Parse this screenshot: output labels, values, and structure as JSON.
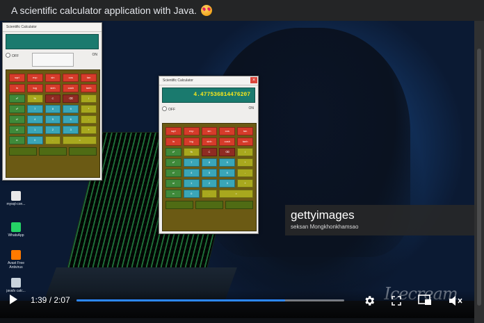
{
  "post": {
    "caption": "A scientific calculator application with Java."
  },
  "desktop_icons": [
    {
      "label": "mysql-con...",
      "color": "#e8e8e8"
    },
    {
      "label": "WhatsApp",
      "color": "#25d366"
    },
    {
      "label": "Avast Free Antivirus",
      "color": "#ff7a00"
    },
    {
      "label": "javafx calc...",
      "color": "#c9d3dc"
    }
  ],
  "calc_small": {
    "title": "Scientific Calculator",
    "display": "",
    "off_label": "OFF",
    "on_label": "ON"
  },
  "calc_large": {
    "title": "Scientific Calculator",
    "display": "4.477536814476207",
    "off_label": "OFF",
    "on_label": "ON"
  },
  "keypad_rows": [
    [
      {
        "label": "sqrt",
        "color": "#d63b2a"
      },
      {
        "label": "exp",
        "color": "#d63b2a"
      },
      {
        "label": "sin",
        "color": "#d63b2a"
      },
      {
        "label": "cos",
        "color": "#d63b2a"
      },
      {
        "label": "tan",
        "color": "#d63b2a"
      }
    ],
    [
      {
        "label": "ln",
        "color": "#d63b2a"
      },
      {
        "label": "log",
        "color": "#d63b2a"
      },
      {
        "label": "sinh",
        "color": "#d63b2a"
      },
      {
        "label": "cosh",
        "color": "#d63b2a"
      },
      {
        "label": "tanh",
        "color": "#d63b2a"
      }
    ],
    [
      {
        "label": "x²",
        "color": "#3f8a3a"
      },
      {
        "label": "%",
        "color": "#a8a81e"
      },
      {
        "label": "C",
        "color": "#8f2b22"
      },
      {
        "label": "⌫",
        "color": "#8f2b22"
      },
      {
        "label": "/",
        "color": "#a8a81e"
      }
    ],
    [
      {
        "label": "x³",
        "color": "#3f8a3a"
      },
      {
        "label": "7",
        "color": "#3aa6b8"
      },
      {
        "label": "8",
        "color": "#3aa6b8"
      },
      {
        "label": "9",
        "color": "#3aa6b8"
      },
      {
        "label": "*",
        "color": "#a8a81e"
      }
    ],
    [
      {
        "label": "xʸ",
        "color": "#3f8a3a"
      },
      {
        "label": "4",
        "color": "#3aa6b8"
      },
      {
        "label": "5",
        "color": "#3aa6b8"
      },
      {
        "label": "6",
        "color": "#3aa6b8"
      },
      {
        "label": "-",
        "color": "#a8a81e"
      }
    ],
    [
      {
        "label": "n!",
        "color": "#3f8a3a"
      },
      {
        "label": "1",
        "color": "#3aa6b8"
      },
      {
        "label": "2",
        "color": "#3aa6b8"
      },
      {
        "label": "3",
        "color": "#3aa6b8"
      },
      {
        "label": "+",
        "color": "#a8a81e"
      }
    ],
    [
      {
        "label": "π",
        "color": "#3f8a3a"
      },
      {
        "label": "0",
        "color": "#3aa6b8"
      },
      {
        "label": ".",
        "color": "#a8a81e"
      },
      {
        "label": "=",
        "color": "#a8a81e"
      }
    ]
  ],
  "keypad_bottom": [
    {
      "label": "",
      "color": "#4f6b14"
    },
    {
      "label": "",
      "color": "#4f6b14"
    },
    {
      "label": "",
      "color": "#4f6b14"
    }
  ],
  "stock_photo": {
    "logo": "gettyimages",
    "credit": "seksan Mongkhonkhamsao"
  },
  "watermark_text": "Icecream",
  "player": {
    "time_current": "1:39",
    "time_total": "2:07",
    "time_display": "1:39 / 2:07",
    "progress_fraction": 0.78,
    "accent_color": "#2d88ff",
    "icons": [
      "play-icon",
      "settings-gear-icon",
      "fullscreen-icon",
      "picture-in-picture-icon",
      "mute-icon"
    ]
  }
}
